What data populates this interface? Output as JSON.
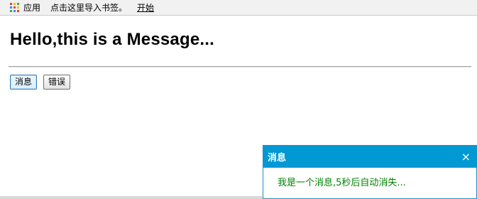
{
  "bookmarks_bar": {
    "apps_label": "应用",
    "import_hint": "点击这里导入书签。",
    "start_link": "开始"
  },
  "page": {
    "title": "Hello,this is a Message...",
    "buttons": {
      "message": "消息",
      "error": "错误"
    }
  },
  "toast": {
    "title": "消息",
    "close": "×",
    "body": "我是一个消息,5秒后自动消失..."
  },
  "colors": {
    "toast_header": "#0099d4",
    "toast_text": "#008000"
  }
}
